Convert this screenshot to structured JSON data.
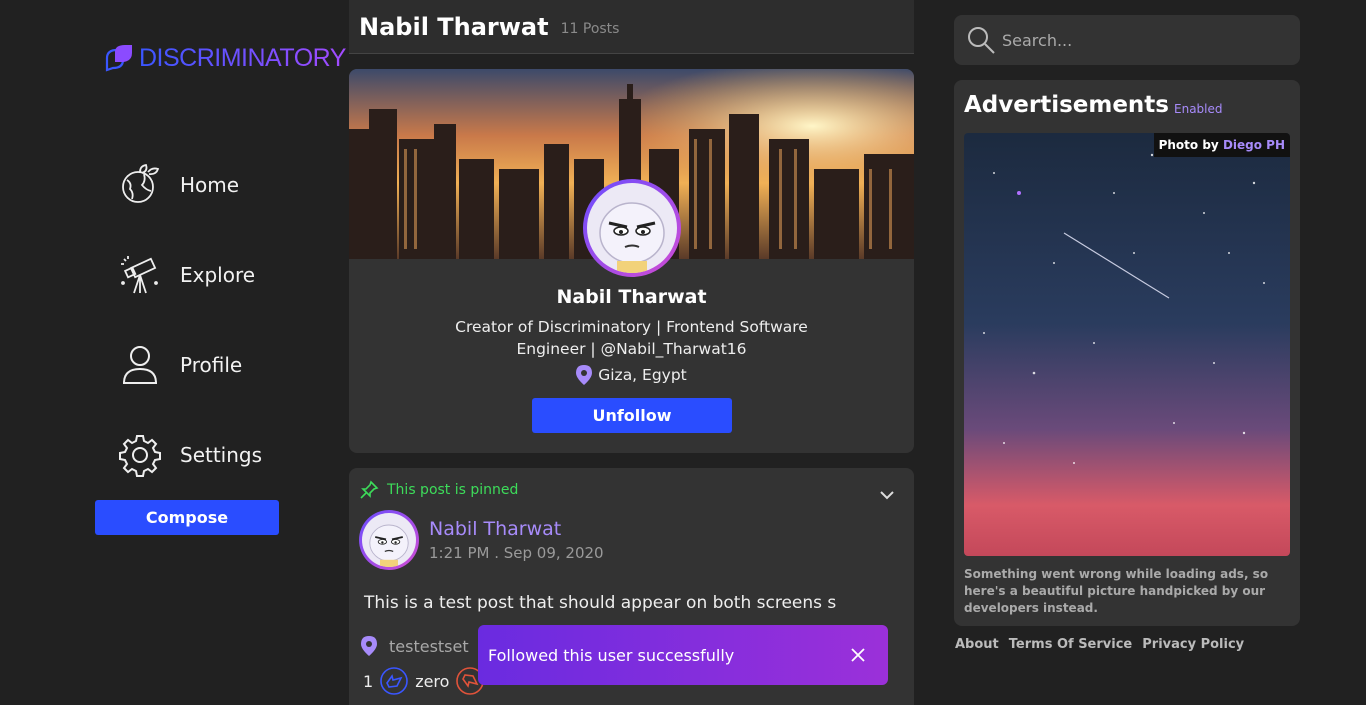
{
  "brand": {
    "name": "DISCRIMINATORY",
    "logo_icon": "leaf-logo-icon"
  },
  "nav": {
    "items": [
      {
        "label": "Home",
        "icon": "globe-plant-icon"
      },
      {
        "label": "Explore",
        "icon": "telescope-icon"
      },
      {
        "label": "Profile",
        "icon": "user-icon"
      },
      {
        "label": "Settings",
        "icon": "gear-icon"
      }
    ],
    "compose_label": "Compose"
  },
  "header": {
    "name": "Nabil Tharwat",
    "post_count": "11 Posts"
  },
  "profile": {
    "name": "Nabil Tharwat",
    "bio": "Creator of Discriminatory | Frontend Software Engineer | @Nabil_Tharwat16",
    "location": "Giza, Egypt",
    "unfollow_label": "Unfollow"
  },
  "post": {
    "pinned_text": "This post is pinned",
    "author": "Nabil Tharwat",
    "time": "1:21 PM . Sep 09, 2020",
    "text": "This is a test post that should appear on both screens s",
    "location": "testestset",
    "like_count": "1",
    "dislike_label": "zero"
  },
  "toast": {
    "message": "Followed this user successfully"
  },
  "search": {
    "placeholder": "Search..."
  },
  "ads": {
    "title": "Advertisements",
    "status": "Enabled",
    "credit_prefix": "Photo by",
    "credit_author": "Diego PH",
    "message": "Something went wrong while loading ads, so here's a beautiful picture handpicked by our developers instead."
  },
  "footer": {
    "links": [
      "About",
      "Terms Of Service",
      "Privacy Policy"
    ]
  },
  "colors": {
    "accent": "#2a4dff",
    "purple": "#a78bfa",
    "pinned_green": "#3ddc5a",
    "background": "#212121",
    "card": "#333333"
  }
}
